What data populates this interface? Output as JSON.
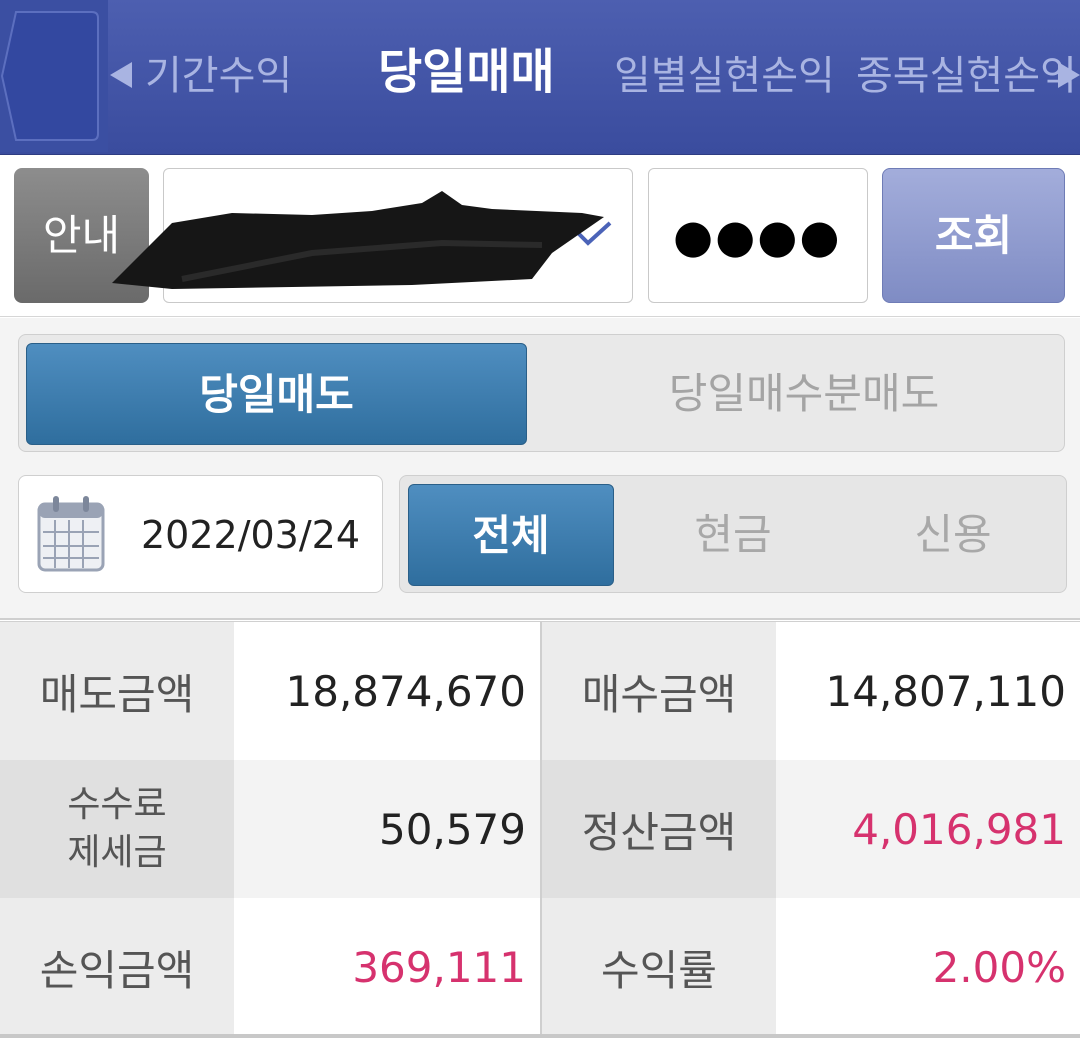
{
  "header": {
    "tabs": [
      {
        "label": "기간수익"
      },
      {
        "label": "당일매매"
      },
      {
        "label": "일별실현손익"
      },
      {
        "label": "종목실현손익"
      }
    ],
    "colors": {
      "background": "#3f52a2",
      "active_tab": "#ffffff",
      "inactive_tab": "#a9b4e2"
    }
  },
  "inputs": {
    "guide_label": "안내",
    "password_value": "●●●●",
    "query_label": "조회"
  },
  "mode_segment": {
    "options": [
      "당일매도",
      "당일매수분매도"
    ],
    "selected": "당일매도"
  },
  "filter": {
    "date": "2022/03/24",
    "type_options": [
      "전체",
      "현금",
      "신용"
    ],
    "selected": "전체"
  },
  "summary": {
    "sell_amount_label": "매도금액",
    "sell_amount": "18,874,670",
    "buy_amount_label": "매수금액",
    "buy_amount": "14,807,110",
    "fee_tax_label_line1": "수수료",
    "fee_tax_label_line2": "제세금",
    "fee_tax": "50,579",
    "settlement_label": "정산금액",
    "settlement": "4,016,981",
    "profit_label": "손익금액",
    "profit": "369,111",
    "return_rate_label": "수익률",
    "return_rate": "2.00%",
    "highlight_color": "#d6326e"
  }
}
